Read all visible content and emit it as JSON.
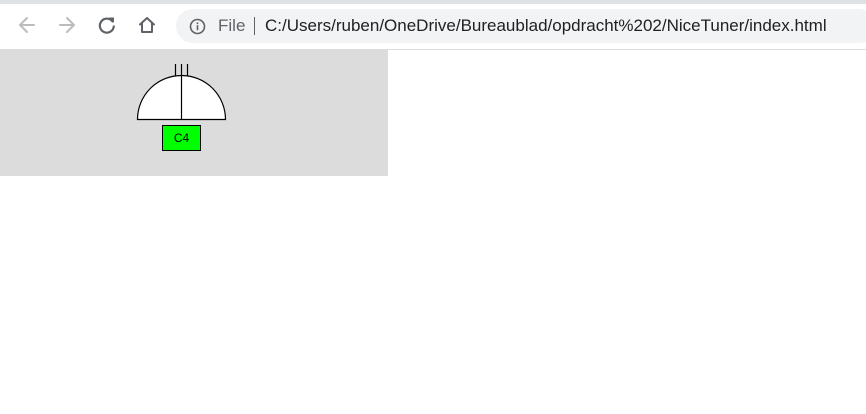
{
  "browser": {
    "back_icon": "arrow-left-icon",
    "forward_icon": "arrow-right-icon",
    "reload_icon": "reload-icon",
    "home_icon": "home-icon",
    "info_icon": "info-icon",
    "scheme_label": "File",
    "url": "C:/Users/ruben/OneDrive/Bureaublad/opdracht%202/NiceTuner/index.html"
  },
  "tuner": {
    "note": "C4",
    "note_color": "#00ff00",
    "panel_color": "#dcdcdc"
  }
}
